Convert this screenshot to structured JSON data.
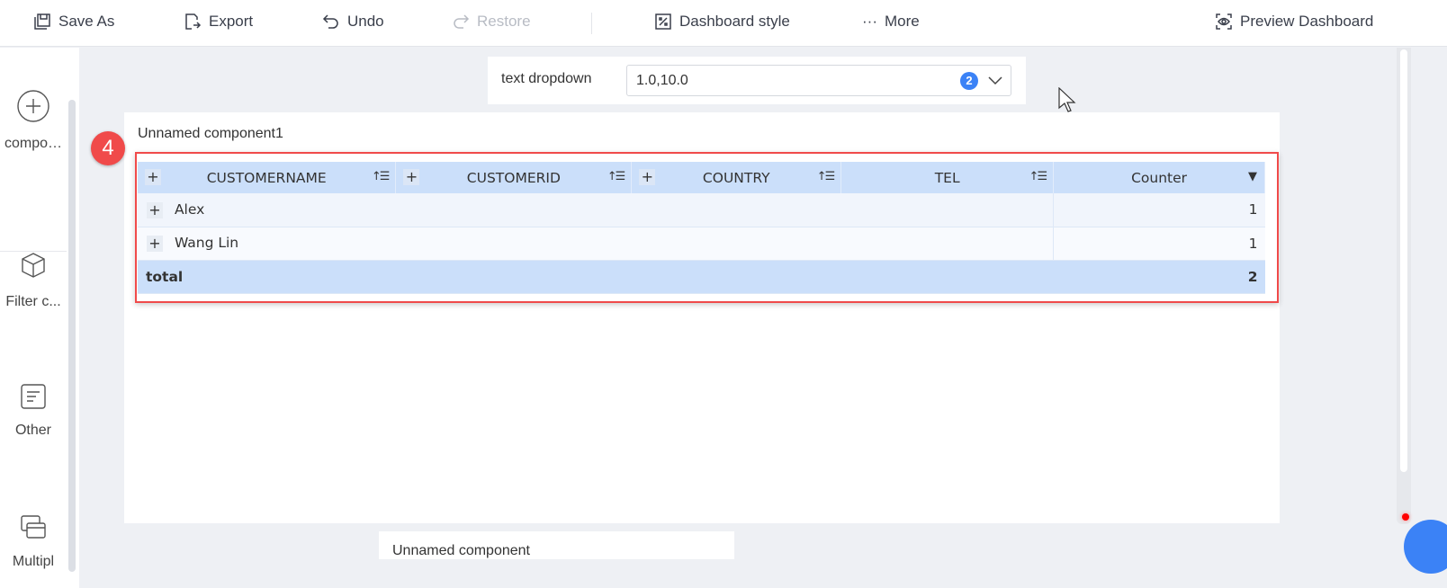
{
  "toolbar": {
    "save_as": "Save As",
    "export": "Export",
    "undo": "Undo",
    "restore": "Restore",
    "dashboard_style": "Dashboard style",
    "more": "More",
    "preview": "Preview Dashboard"
  },
  "sidebar": {
    "items": [
      {
        "label": "compo…"
      },
      {
        "label": "Filter c..."
      },
      {
        "label": "Other"
      },
      {
        "label": "Multipl"
      }
    ]
  },
  "filter": {
    "label": "text dropdown",
    "value": "1.0,10.0",
    "count": "2"
  },
  "component": {
    "title": "Unnamed component1",
    "step_number": "4",
    "columns": [
      "CUSTOMERNAME",
      "CUSTOMERID",
      "COUNTRY",
      "TEL",
      "Counter"
    ],
    "rows": [
      {
        "name": "Alex",
        "counter": "1"
      },
      {
        "name": "Wang Lin",
        "counter": "1"
      }
    ],
    "total": {
      "label": "total",
      "value": "2"
    }
  },
  "bottom_component": {
    "title": "Unnamed component"
  }
}
